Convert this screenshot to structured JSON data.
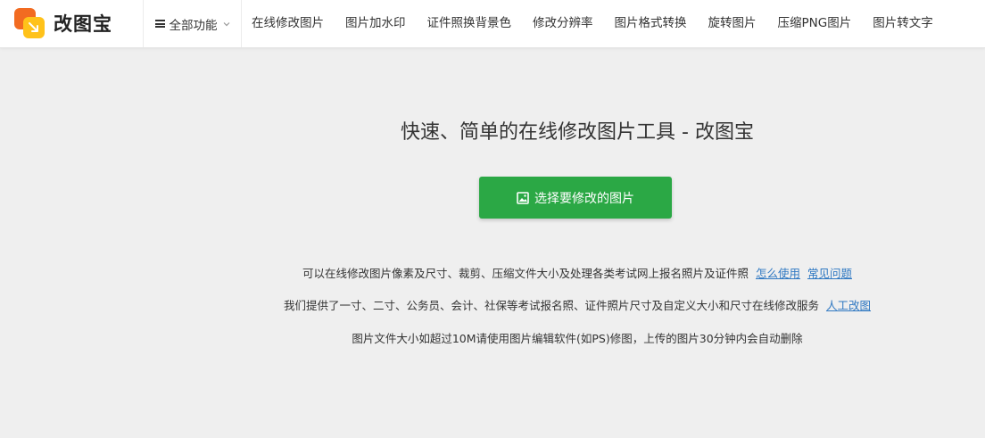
{
  "brand": {
    "name": "改图宝"
  },
  "nav": {
    "all_label": "全部功能",
    "items": [
      "在线修改图片",
      "图片加水印",
      "证件照换背景色",
      "修改分辨率",
      "图片格式转换",
      "旋转图片",
      "压缩PNG图片",
      "图片转文字"
    ]
  },
  "main": {
    "headline": "快速、简单的在线修改图片工具 - 改图宝",
    "upload_label": "选择要修改的图片",
    "lines": [
      {
        "text": "可以在线修改图片像素及尺寸、裁剪、压缩文件大小及处理各类考试网上报名照片及证件照",
        "links": [
          "怎么使用",
          "常见问题"
        ]
      },
      {
        "text": "我们提供了一寸、二寸、公务员、会计、社保等考试报名照、证件照片尺寸及自定义大小和尺寸在线修改服务",
        "links": [
          "人工改图"
        ]
      },
      {
        "text": "图片文件大小如超过10M请使用图片编辑软件(如PS)修图，上传的图片30分钟内会自动删除",
        "links": []
      }
    ]
  },
  "colors": {
    "accent": "#2ba845",
    "link": "#2f78c2",
    "logo_orange": "#f26b21",
    "logo_yellow": "#ffc21a"
  },
  "icons": {
    "menu": "hamburger-icon",
    "dropdown": "chevron-down-icon",
    "upload": "image-icon"
  }
}
